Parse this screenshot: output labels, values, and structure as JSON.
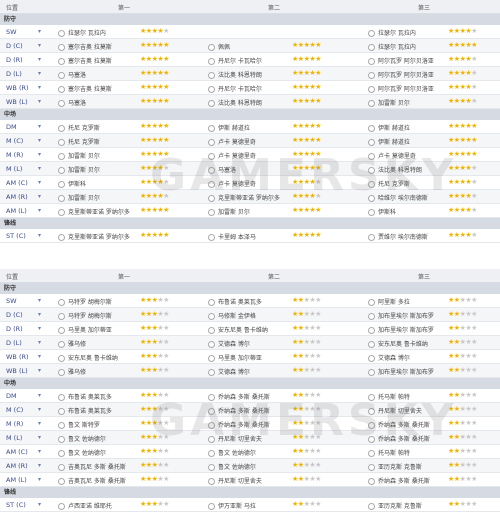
{
  "tables": [
    {
      "headers": {
        "position": "位置",
        "first": "第一",
        "second": "第二",
        "third": "第三"
      },
      "sections": [
        {
          "title": "防守",
          "rows": [
            {
              "pos": "SW",
              "c1": "拉瑟尔 瓦拉内",
              "s1": 4,
              "c2": "",
              "s2": 0,
              "c3": "拉瑟尔 瓦拉内",
              "s3": 4
            },
            {
              "pos": "D (C)",
              "c1": "塞尔吉奥 拉莫斯",
              "s1": 5,
              "c2": "佩佩",
              "s2": 5,
              "c3": "拉瑟尔 瓦拉内",
              "s3": 5
            },
            {
              "pos": "D (R)",
              "c1": "塞尔吉奥 拉莫斯",
              "s1": 5,
              "c2": "丹尼尔 卡瓦哈尔",
              "s2": 5,
              "c3": "阿尔瓦罗 阿尔贝洛亚",
              "s3": 4
            },
            {
              "pos": "D (L)",
              "c1": "马塞洛",
              "s1": 5,
              "c2": "法比奥 科恩特朗",
              "s2": 5,
              "c3": "阿尔瓦罗 阿尔贝洛亚",
              "s3": 4
            },
            {
              "pos": "WB (R)",
              "c1": "塞尔吉奥 拉莫斯",
              "s1": 5,
              "c2": "丹尼尔 卡瓦哈尔",
              "s2": 5,
              "c3": "阿尔瓦罗 阿尔贝洛亚",
              "s3": 4
            },
            {
              "pos": "WB (L)",
              "c1": "马塞洛",
              "s1": 5,
              "c2": "法比奥 科恩特朗",
              "s2": 5,
              "c3": "加雷斯 贝尔",
              "s3": 4
            }
          ]
        },
        {
          "title": "中场",
          "rows": [
            {
              "pos": "DM",
              "c1": "托尼 克罗斯",
              "s1": 5,
              "c2": "伊斯 赫道拉",
              "s2": 5,
              "c3": "伊斯 赫道拉",
              "s3": 5
            },
            {
              "pos": "M (C)",
              "c1": "托尼 克罗斯",
              "s1": 5,
              "c2": "卢卡 莫德里奇",
              "s2": 5,
              "c3": "伊斯 赫道拉",
              "s3": 5
            },
            {
              "pos": "M (R)",
              "c1": "加雷斯 贝尔",
              "s1": 5,
              "c2": "卢卡 莫德里奇",
              "s2": 5,
              "c3": "卢卡 莫德里奇",
              "s3": 5
            },
            {
              "pos": "M (L)",
              "c1": "加雷斯 贝尔",
              "s1": 4,
              "c2": "马塞洛",
              "s2": 5,
              "c3": "法比奥 科恩特朗",
              "s3": 4
            },
            {
              "pos": "AM (C)",
              "c1": "伊斯科",
              "s1": 4,
              "c2": "卢卡 莫德里奇",
              "s2": 4,
              "c3": "托尼 克罗斯",
              "s3": 4
            },
            {
              "pos": "AM (R)",
              "c1": "加雷斯 贝尔",
              "s1": 4,
              "c2": "克里斯蒂亚诺 罗纳尔多",
              "s2": 4,
              "c3": "哈维尔 埃尔南德斯",
              "s3": 4
            },
            {
              "pos": "AM (L)",
              "c1": "克里斯蒂亚诺 罗纳尔多",
              "s1": 5,
              "c2": "加雷斯 贝尔",
              "s2": 5,
              "c3": "伊斯科",
              "s3": 4
            }
          ]
        },
        {
          "title": "锋线",
          "rows": [
            {
              "pos": "ST (C)",
              "c1": "克里斯蒂亚诺 罗纳尔多",
              "s1": 5,
              "c2": "卡里姆 本泽马",
              "s2": 5,
              "c3": "贾维尔 埃尔南德斯",
              "s3": 4
            }
          ]
        }
      ]
    },
    {
      "headers": {
        "position": "位置",
        "first": "第一",
        "second": "第二",
        "third": "第三"
      },
      "sections": [
        {
          "title": "防守",
          "rows": [
            {
              "pos": "SW",
              "c1": "马特罗 胡梅尔斯",
              "s1": 3,
              "c2": "布鲁诺 奥莱瓦多",
              "s2": 2,
              "c3": "阿里斯 多拉",
              "s3": 2
            },
            {
              "pos": "D (C)",
              "c1": "马特罗 胡梅尔斯",
              "s1": 3,
              "c2": "马修斯 金伊格",
              "s2": 2,
              "c3": "加布里埃尔 斯加布罗",
              "s3": 2
            },
            {
              "pos": "D (R)",
              "c1": "马里奥 加尔蒂亚",
              "s1": 3,
              "c2": "安东尼奥 鲁卡维纳",
              "s2": 2,
              "c3": "加布里埃尔 斯加布罗",
              "s3": 2
            },
            {
              "pos": "D (L)",
              "c1": "雅乌修",
              "s1": 3,
              "c2": "艾德森 博尔",
              "s2": 2,
              "c3": "安东尼奥 鲁卡维纳",
              "s3": 2
            },
            {
              "pos": "WB (R)",
              "c1": "安东尼奥 鲁卡维纳",
              "s1": 3,
              "c2": "马里奥 加尔蒂亚",
              "s2": 2,
              "c3": "艾德森 博尔",
              "s3": 2
            },
            {
              "pos": "WB (L)",
              "c1": "雅乌修",
              "s1": 3,
              "c2": "艾德森 博尔",
              "s2": 2,
              "c3": "加布里埃尔 斯加布罗",
              "s3": 2
            }
          ]
        },
        {
          "title": "中场",
          "rows": [
            {
              "pos": "DM",
              "c1": "布鲁诺 奥莱瓦多",
              "s1": 3,
              "c2": "乔纳森 多斯 桑托斯",
              "s2": 2,
              "c3": "托马斯 帕特",
              "s3": 2
            },
            {
              "pos": "M (C)",
              "c1": "布鲁诺 奥莱瓦多",
              "s1": 3,
              "c2": "乔纳森 多斯 桑托斯",
              "s2": 2,
              "c3": "丹尼斯 切里舍夫",
              "s3": 2
            },
            {
              "pos": "M (R)",
              "c1": "鲁文 斯特罗",
              "s1": 3,
              "c2": "乔纳森 多斯 桑托斯",
              "s2": 2,
              "c3": "乔纳森 多斯 桑托斯",
              "s3": 2
            },
            {
              "pos": "M (L)",
              "c1": "鲁文 佐纳德尔",
              "s1": 3,
              "c2": "丹尼斯 切里舍夫",
              "s2": 2,
              "c3": "乔纳森 多斯 桑托斯",
              "s3": 2
            },
            {
              "pos": "AM (C)",
              "c1": "鲁文 佐纳德尔",
              "s1": 3,
              "c2": "鲁文 佐纳德尔",
              "s2": 2,
              "c3": "托马斯 帕特",
              "s3": 2
            },
            {
              "pos": "AM (R)",
              "c1": "吉奥瓦尼 多斯 桑托斯",
              "s1": 3,
              "c2": "鲁文 佐纳德尔",
              "s2": 2,
              "c3": "亚历克斯 克鲁斯",
              "s3": 2
            },
            {
              "pos": "AM (L)",
              "c1": "吉奥瓦尼 多斯 桑托斯",
              "s1": 3,
              "c2": "丹尼斯 切里舍夫",
              "s2": 2,
              "c3": "乔纳森 多斯 桑托斯",
              "s3": 2
            }
          ]
        },
        {
          "title": "锋线",
          "rows": [
            {
              "pos": "ST (C)",
              "c1": "卢西亚诺 维耶托",
              "s1": 3,
              "c2": "伊万亚斯 马拉",
              "s2": 2,
              "c3": "亚历克斯 克鲁斯",
              "s3": 2
            }
          ]
        }
      ]
    }
  ],
  "watermark": "GAMERSKY",
  "colors": {
    "star_on": "#f0b400",
    "star_off": "#c8c8c8",
    "pos_text": "#3a4b8c",
    "section_bg": "#d6dae2"
  }
}
